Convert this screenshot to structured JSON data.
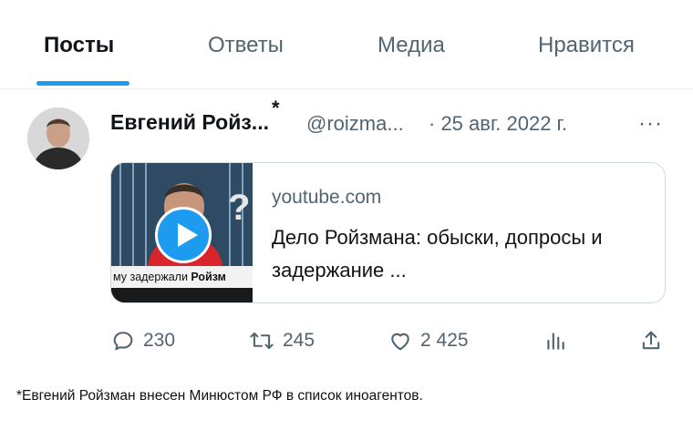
{
  "tabs": [
    {
      "label": "Посты",
      "active": true
    },
    {
      "label": "Ответы",
      "active": false
    },
    {
      "label": "Медиа",
      "active": false
    },
    {
      "label": "Нравится",
      "active": false
    }
  ],
  "post": {
    "author_name": "Евгений Ройз...",
    "footnote_mark": "*",
    "handle": "@roizma...",
    "date": "· 25 авг. 2022 г.",
    "more_label": "···"
  },
  "link_card": {
    "domain": "youtube.com",
    "title": "Дело Ройзмана: обыски, допросы и задержание ...",
    "thumbnail_caption_prefix": "му задержали ",
    "thumbnail_caption_bold": "Ройзм"
  },
  "actions": {
    "replies": "230",
    "reposts": "245",
    "likes": "2 425"
  },
  "footnote": "*Евгений Ройзман внесен Минюстом РФ в список иноагентов.",
  "colors": {
    "accent": "#1d9bf0",
    "text": "#0f1419",
    "secondary": "#536471"
  }
}
